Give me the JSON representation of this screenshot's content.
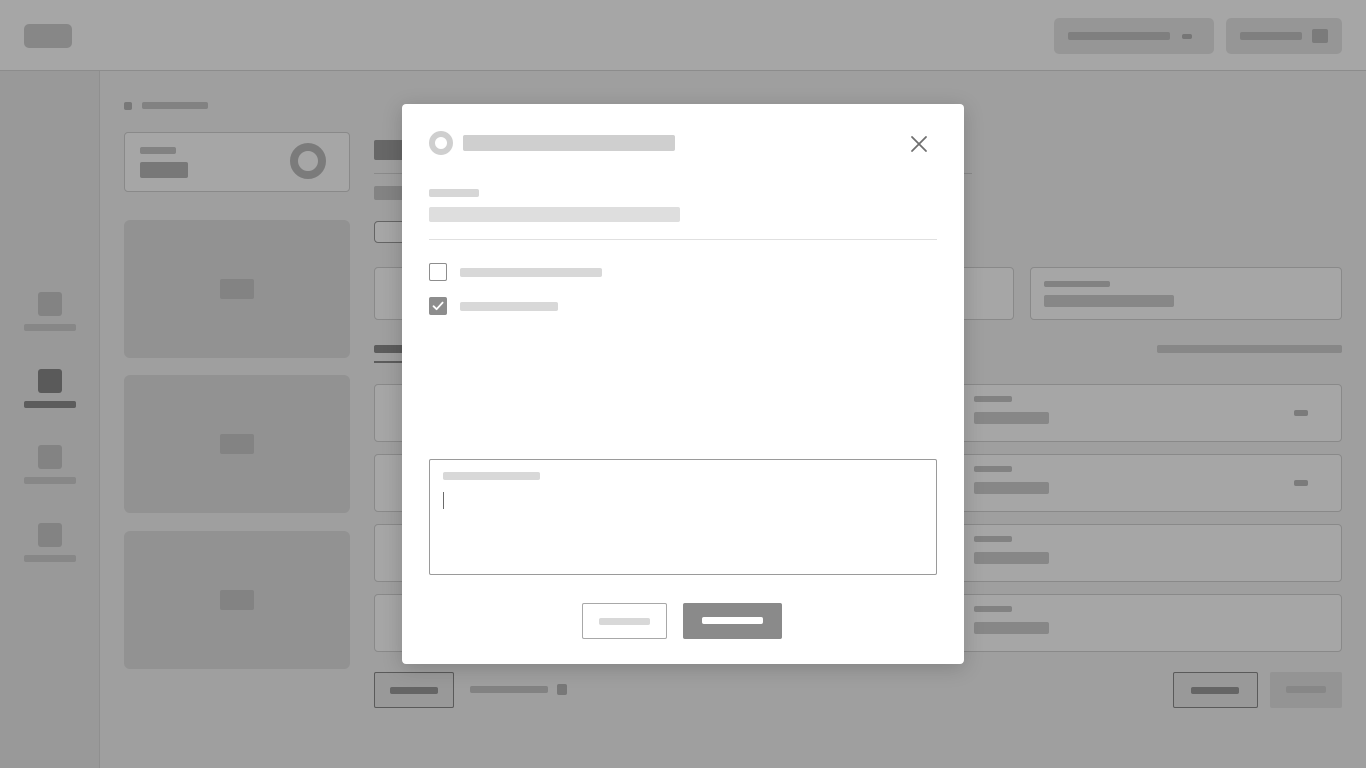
{
  "modal": {
    "title": "",
    "field_label": "",
    "field_value": "",
    "options": [
      {
        "label": "",
        "checked": false
      },
      {
        "label": "",
        "checked": true
      }
    ],
    "notes": {
      "label": "",
      "value": ""
    },
    "actions": {
      "cancel_label": "",
      "confirm_label": ""
    }
  },
  "icons": {
    "header": "status-ring-icon",
    "close": "close-icon",
    "check": "checkmark-icon"
  },
  "colors": {
    "overlay": "#000000",
    "placeholder": "#d0d0d0",
    "checkbox_checked": "#8d8d8d",
    "primary_button": "#8a8a8a"
  }
}
